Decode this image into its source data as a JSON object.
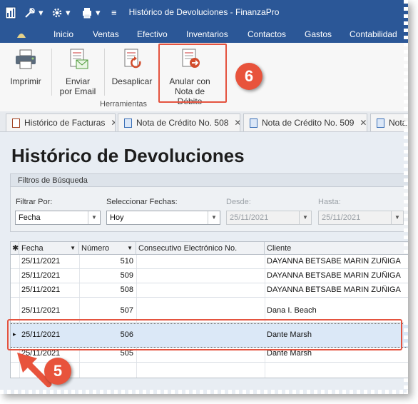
{
  "window": {
    "title": "Histórico de Devoluciones - FinanzaPro",
    "quick_access": [
      "▾",
      "▾",
      "▾",
      "≡"
    ]
  },
  "menu": [
    "Inicio",
    "Ventas",
    "Efectivo",
    "Inventarios",
    "Contactos",
    "Gastos",
    "Contabilidad"
  ],
  "ribbon": {
    "buttons": {
      "print": "Imprimir",
      "send_line1": "Enviar",
      "send_line2": "por Email",
      "unapply": "Desaplicar",
      "annul_line1": "Anular con",
      "annul_line2": "Nota de Débito"
    },
    "group_label": "Herramientas"
  },
  "callouts": {
    "badge6": "6",
    "badge5": "5"
  },
  "tabs": [
    {
      "label": "Histórico de Facturas",
      "close": "✕"
    },
    {
      "label": "Nota de Crédito No. 508",
      "close": "✕"
    },
    {
      "label": "Nota de Crédito No. 509",
      "close": "✕"
    },
    {
      "label": "Nota"
    }
  ],
  "page_title": "Histórico de Devoluciones",
  "filters": {
    "title": "Filtros de Búsqueda",
    "filter_by_label": "Filtrar Por:",
    "filter_by_value": "Fecha",
    "dates_label": "Seleccionar Fechas:",
    "dates_value": "Hoy",
    "from_label": "Desde:",
    "from_value": "25/11/2021",
    "to_label": "Hasta:",
    "to_value": "25/11/2021"
  },
  "grid": {
    "headers": {
      "marker": "✱",
      "fecha": "Fecha",
      "numero": "Número",
      "consecutivo": "Consecutivo Electrónico No.",
      "cliente": "Cliente"
    },
    "rows": [
      {
        "fecha": "25/11/2021",
        "numero": "510",
        "cliente": "DAYANNA BETSABE MARIN ZUÑIGA"
      },
      {
        "fecha": "25/11/2021",
        "numero": "509",
        "cliente": "DAYANNA BETSABE MARIN ZUÑIGA"
      },
      {
        "fecha": "25/11/2021",
        "numero": "508",
        "cliente": "DAYANNA BETSABE MARIN ZUÑIGA"
      },
      {
        "fecha": "25/11/2021",
        "numero": "507",
        "cliente": "Dana I. Beach"
      },
      {
        "fecha": "25/11/2021",
        "numero": "506",
        "cliente": "Dante Marsh"
      },
      {
        "fecha": "25/11/2021",
        "numero": "505",
        "cliente": "Dante Marsh"
      }
    ],
    "selected_marker": "▸"
  }
}
